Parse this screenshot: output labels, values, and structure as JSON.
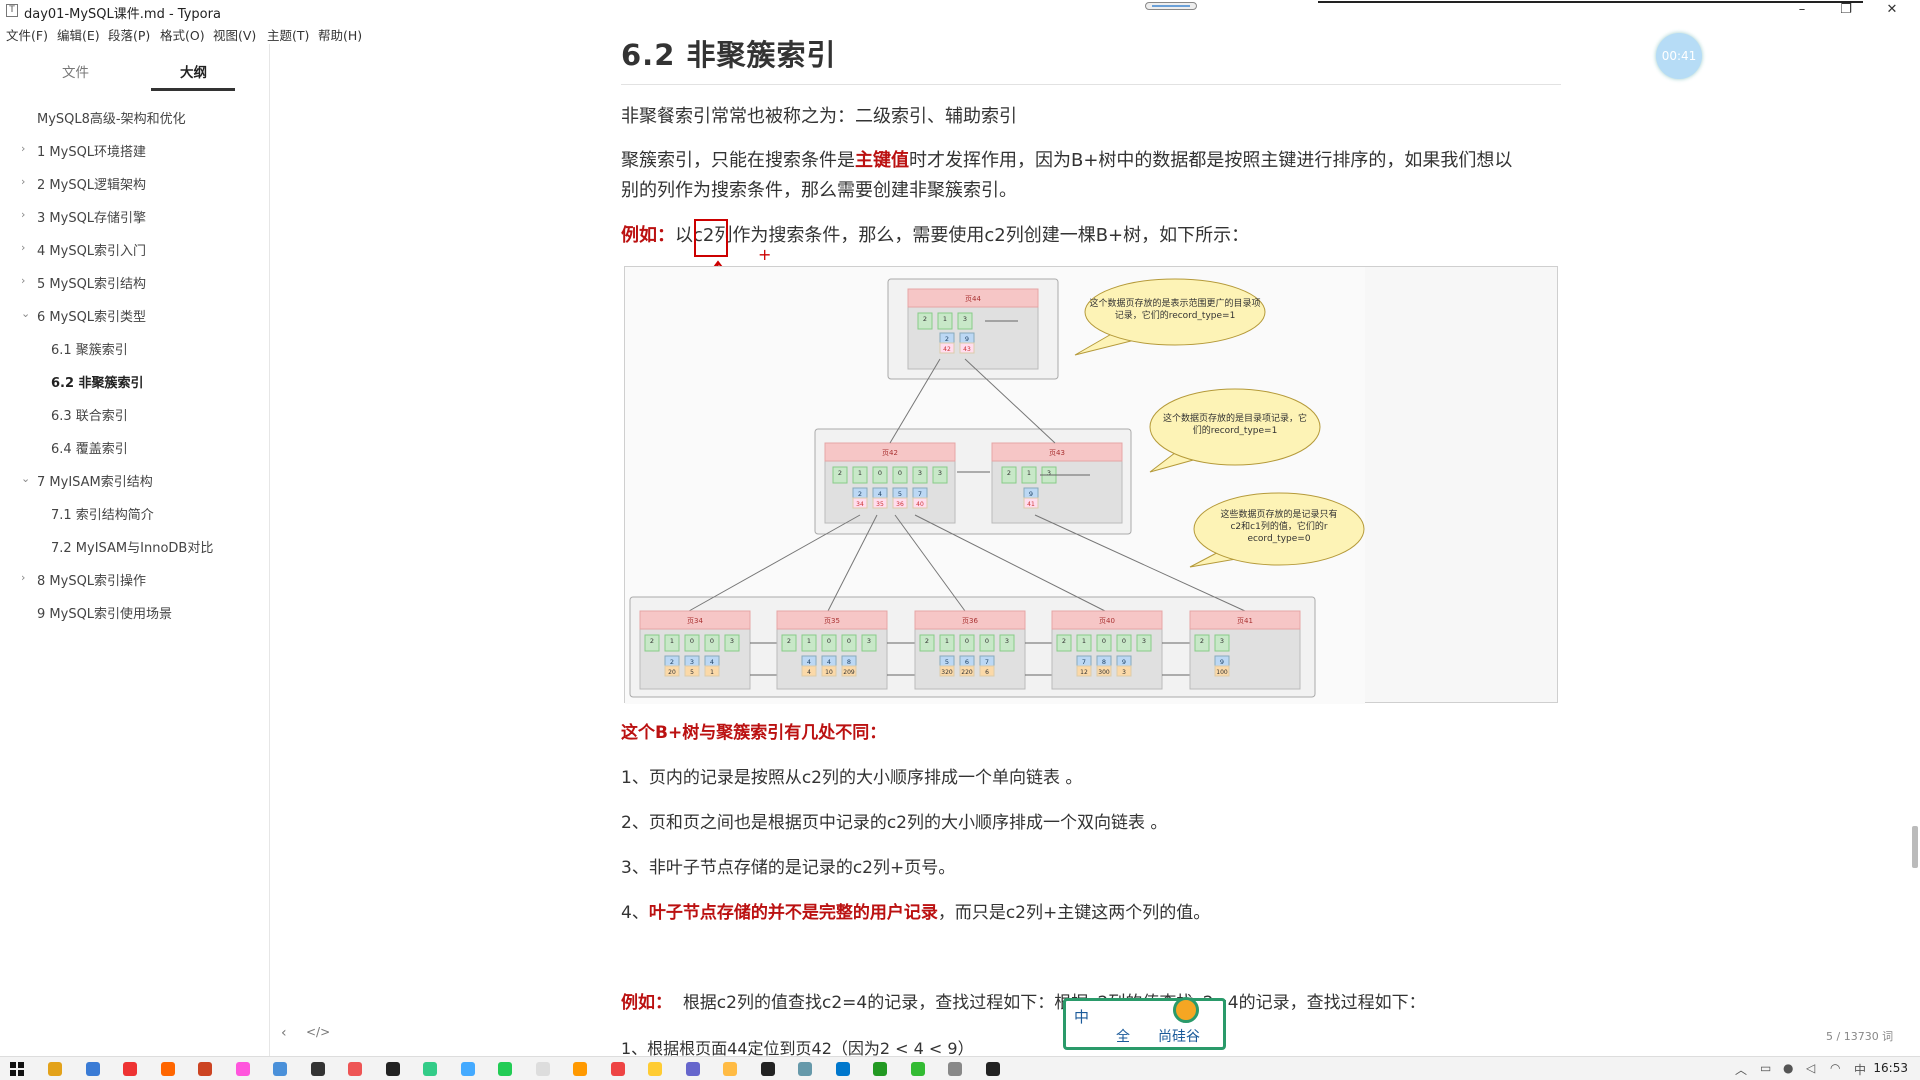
{
  "window": {
    "title": "day01-MySQL课件.md - Typora",
    "minimize": "–",
    "restore": "❐",
    "close": "✕"
  },
  "menubar": [
    "文件(F)",
    "编辑(E)",
    "段落(P)",
    "格式(O)",
    "视图(V)",
    "主题(T)",
    "帮助(H)"
  ],
  "sidebar": {
    "tabs": [
      "文件",
      "大纲"
    ],
    "active_tab": "大纲",
    "outline": [
      {
        "label": "MySQL8高级-架构和优化",
        "level": 0,
        "caret": ""
      },
      {
        "label": "1 MySQL环境搭建",
        "level": 1,
        "caret": "›"
      },
      {
        "label": "2 MySQL逻辑架构",
        "level": 1,
        "caret": "›"
      },
      {
        "label": "3 MySQL存储引擎",
        "level": 1,
        "caret": "›"
      },
      {
        "label": "4 MySQL索引入门",
        "level": 1,
        "caret": "›"
      },
      {
        "label": "5 MySQL索引结构",
        "level": 1,
        "caret": "›"
      },
      {
        "label": "6 MySQL索引类型",
        "level": 1,
        "caret": "⌄"
      },
      {
        "label": "6.1 聚簇索引",
        "level": 2,
        "caret": ""
      },
      {
        "label": "6.2 非聚簇索引",
        "level": 2,
        "caret": "",
        "active": true
      },
      {
        "label": "6.3 联合索引",
        "level": 2,
        "caret": ""
      },
      {
        "label": "6.4 覆盖索引",
        "level": 2,
        "caret": ""
      },
      {
        "label": "7 MyISAM索引结构",
        "level": 1,
        "caret": "⌄"
      },
      {
        "label": "7.1 索引结构简介",
        "level": 2,
        "caret": ""
      },
      {
        "label": "7.2 MyISAM与InnoDB对比",
        "level": 2,
        "caret": ""
      },
      {
        "label": "8 MySQL索引操作",
        "level": 1,
        "caret": "›"
      },
      {
        "label": "9 MySQL索引使用场景",
        "level": 1,
        "caret": ""
      }
    ],
    "footer_left": "‹",
    "footer_code": "</>"
  },
  "content": {
    "heading": "6.2 非聚簇索引",
    "p1": "非聚餐索引常常也被称之为：二级索引、辅助索引",
    "p2_a": "聚簇索引，只能在搜索条件是",
    "p2_b": "主键值",
    "p2_c": "时才发挥作用，因为B+树中的数据都是按照主键进行排序的，如果我们想以",
    "p2_d": "别的列作为搜索条件，那么需要创建非聚簇索引。",
    "p3_a": "例如：",
    "p3_b": "以c2列作为搜索条件，那么，需要使用c2列创建一棵B+树，如下所示：",
    "diff_title": "这个B+树与聚簇索引有几处不同：",
    "diff1": "1、页内的记录是按照从c2列的大小顺序排成一个单向链表 。",
    "diff2": "2、页和页之间也是根据页中记录的c2列的大小顺序排成一个双向链表 。",
    "diff3": "3、非叶子节点存储的是记录的c2列+页号。",
    "diff4_a": "4、",
    "diff4_b": "叶子节点存储的并不是完整的用户记录",
    "diff4_c": "，而只是c2列+主键这两个列的值。",
    "p4_a": "例如：",
    "p4_b": "根据c2列的值查找c2=4的记录，查找过程如下：根据c2列的值查找c2=4的记录，查找过程如下：",
    "p5": "1、根据根页面44定位到页42（因为2 < 4 < 9）"
  },
  "figure": {
    "pages": {
      "p44": "页44",
      "p42": "页42",
      "p43": "页43",
      "p34": "页34",
      "p35": "页35",
      "p36": "页36",
      "p40": "页40",
      "p41": "页41"
    },
    "bubble1": "这个数据页存放的是表示范围更广的目录项记录，它们的record_type=1",
    "bubble2": "这个数据页存放的是目录项记录，它们的record_type=1",
    "bubble3": "这些数据页存放的是记录只有c2和c1列的值，它们的record_type=0",
    "p44_keys": [
      "2",
      "9"
    ],
    "p44_ptrs": [
      "42",
      "43"
    ],
    "p42_keys": [
      "2",
      "4",
      "5",
      "7"
    ],
    "p42_ptrs": [
      "34",
      "35",
      "36",
      "40"
    ],
    "p43_keys": [
      "9"
    ],
    "p43_ptrs": [
      "41"
    ],
    "leaf_keys": [
      [
        "2",
        "3",
        "4"
      ],
      [
        "4",
        "4",
        "8"
      ],
      [
        "5",
        "6",
        "7"
      ],
      [
        "7",
        "8",
        "9"
      ],
      [
        "9"
      ]
    ],
    "leaf_vals": [
      [
        "20",
        "5",
        "1"
      ],
      [
        "4",
        "10",
        "209"
      ],
      [
        "320",
        "220",
        "6"
      ],
      [
        "12",
        "300",
        "3"
      ],
      [
        "100"
      ]
    ],
    "header_nums": [
      "2",
      "1",
      "0",
      "0",
      "3"
    ]
  },
  "overlay": {
    "timer": "00:41",
    "wordcount": "5 / 13730 词"
  },
  "ime": {
    "zh": "中",
    "full": "全",
    "brand": "尚硅谷"
  },
  "taskbar": {
    "clock": "16:53"
  }
}
